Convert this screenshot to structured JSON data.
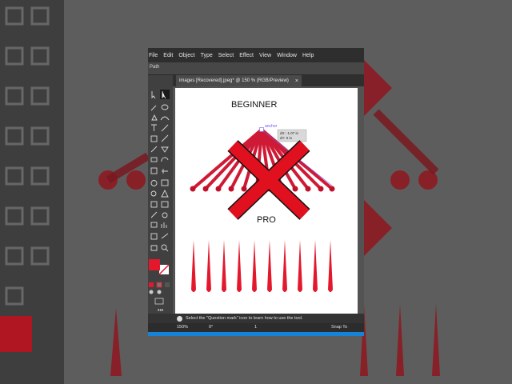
{
  "menu": [
    "File",
    "Edit",
    "Object",
    "Type",
    "Select",
    "Effect",
    "View",
    "Window",
    "Help"
  ],
  "control_bar": {
    "label": "Path"
  },
  "document_tab": {
    "title": "images [Recovered].jpeg* @ 150 % (RGB/Preview)",
    "close": "×"
  },
  "artboard": {
    "beginner_label": "BEGINNER",
    "pro_label": "PRO",
    "anchor_label": "anchor",
    "tooltip_dx": "dX: -1.07 in",
    "tooltip_dy": "dY: 0 in"
  },
  "status": {
    "help": "?",
    "message": "Select the \"Question mark\" icon to learn how to use the tool."
  },
  "bottom": {
    "zoom": "150%",
    "rotation": "0°",
    "artboard_num": "1",
    "snap": "Snap To"
  },
  "colors": {
    "accent_red": "#e3182d",
    "cross_red": "#e0101f",
    "selection_blue": "#1583d8"
  }
}
